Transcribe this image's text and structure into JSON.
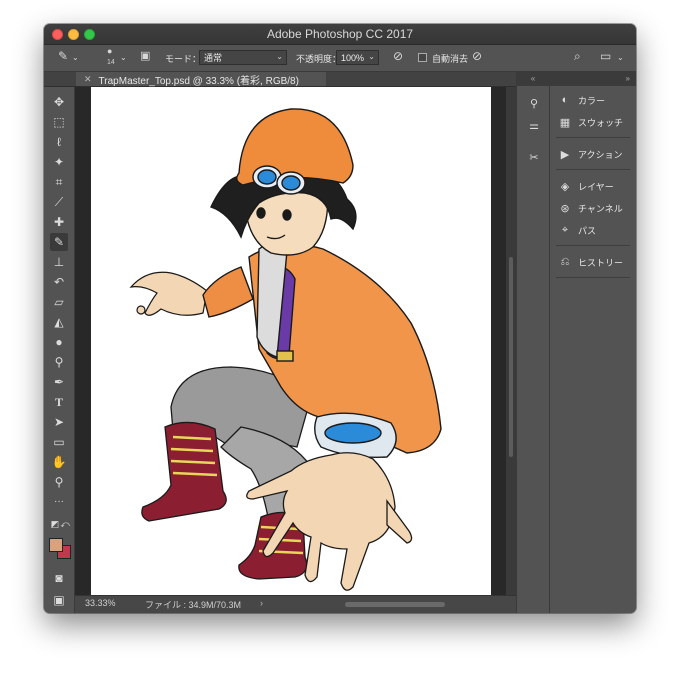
{
  "window": {
    "title": "Adobe Photoshop CC 2017"
  },
  "options_bar": {
    "brush_size": "14",
    "mode_label": "モード：",
    "mode_value": "通常",
    "opacity_label": "不透明度：",
    "opacity_value": "100%",
    "auto_erase_label": "自動消去"
  },
  "document": {
    "tab_title": "TrapMaster_Top.psd @ 33.3% (着彩, RGB/8)"
  },
  "status": {
    "zoom": "33.33%",
    "file_info": "ファイル : 34.9M/70.3M",
    "arrow": "›"
  },
  "panels": {
    "items": [
      {
        "label": "カラー",
        "icon": "color-palette-icon"
      },
      {
        "label": "スウォッチ",
        "icon": "swatches-grid-icon"
      },
      {
        "label": "アクション",
        "icon": "play-icon"
      },
      {
        "label": "レイヤー",
        "icon": "layers-icon"
      },
      {
        "label": "チャンネル",
        "icon": "channels-icon"
      },
      {
        "label": "パス",
        "icon": "paths-icon"
      },
      {
        "label": "ヒストリー",
        "icon": "history-icon"
      }
    ]
  },
  "colors": {
    "foreground": "#d7a27c",
    "background": "#c2394d",
    "ui": "#535353"
  }
}
